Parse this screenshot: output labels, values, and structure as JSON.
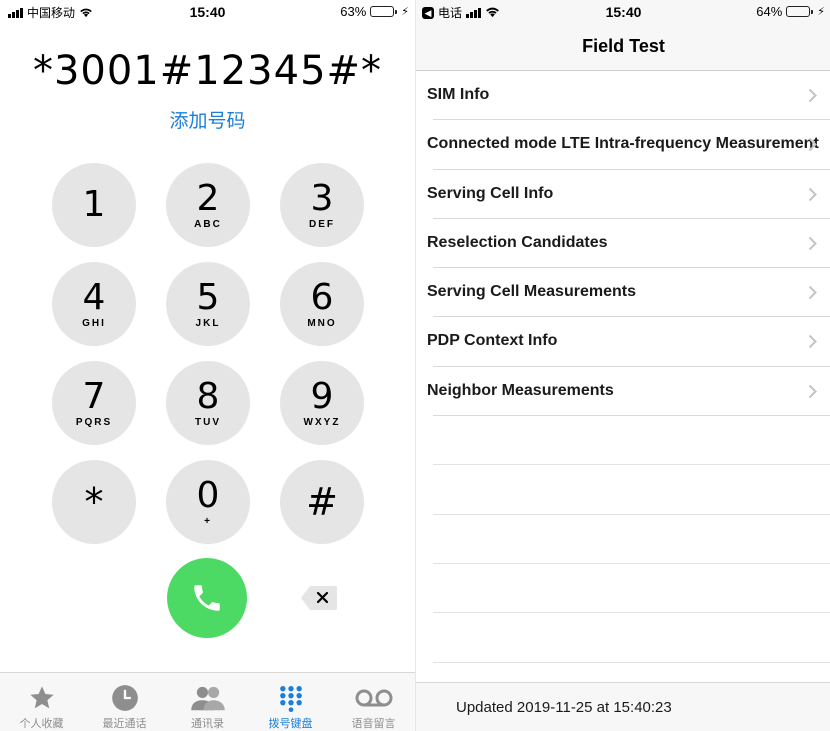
{
  "left": {
    "status": {
      "carrier": "中国移动",
      "time": "15:40",
      "battery": "63%",
      "battery_level": 0.63
    },
    "dialed": "*3001#12345#*",
    "add_number": "添加号码",
    "keypad": [
      {
        "digit": "1",
        "letters": ""
      },
      {
        "digit": "2",
        "letters": "ABC"
      },
      {
        "digit": "3",
        "letters": "DEF"
      },
      {
        "digit": "4",
        "letters": "GHI"
      },
      {
        "digit": "5",
        "letters": "JKL"
      },
      {
        "digit": "6",
        "letters": "MNO"
      },
      {
        "digit": "7",
        "letters": "PQRS"
      },
      {
        "digit": "8",
        "letters": "TUV"
      },
      {
        "digit": "9",
        "letters": "WXYZ"
      },
      {
        "digit": "*",
        "letters": ""
      },
      {
        "digit": "0",
        "letters": "+"
      },
      {
        "digit": "#",
        "letters": ""
      }
    ],
    "tabs": [
      {
        "label": "个人收藏",
        "icon": "star-icon"
      },
      {
        "label": "最近通话",
        "icon": "clock-icon"
      },
      {
        "label": "通讯录",
        "icon": "contacts-icon"
      },
      {
        "label": "拨号键盘",
        "icon": "keypad-icon",
        "active": true
      },
      {
        "label": "语音留言",
        "icon": "voicemail-icon"
      }
    ]
  },
  "right": {
    "status": {
      "back_app": "电话",
      "time": "15:40",
      "battery": "64%",
      "battery_level": 0.64
    },
    "title": "Field Test",
    "menu": [
      "SIM Info",
      "Connected mode LTE Intra-frequency Measurement",
      "Serving Cell Info",
      "Reselection Candidates",
      "Serving Cell Measurements",
      "PDP Context Info",
      "Neighbor Measurements"
    ],
    "updated": "Updated 2019-11-25 at 15:40:23"
  },
  "colors": {
    "accent": "#1a7fd6",
    "call_green": "#4cd964",
    "key_gray": "#e5e5e5"
  }
}
